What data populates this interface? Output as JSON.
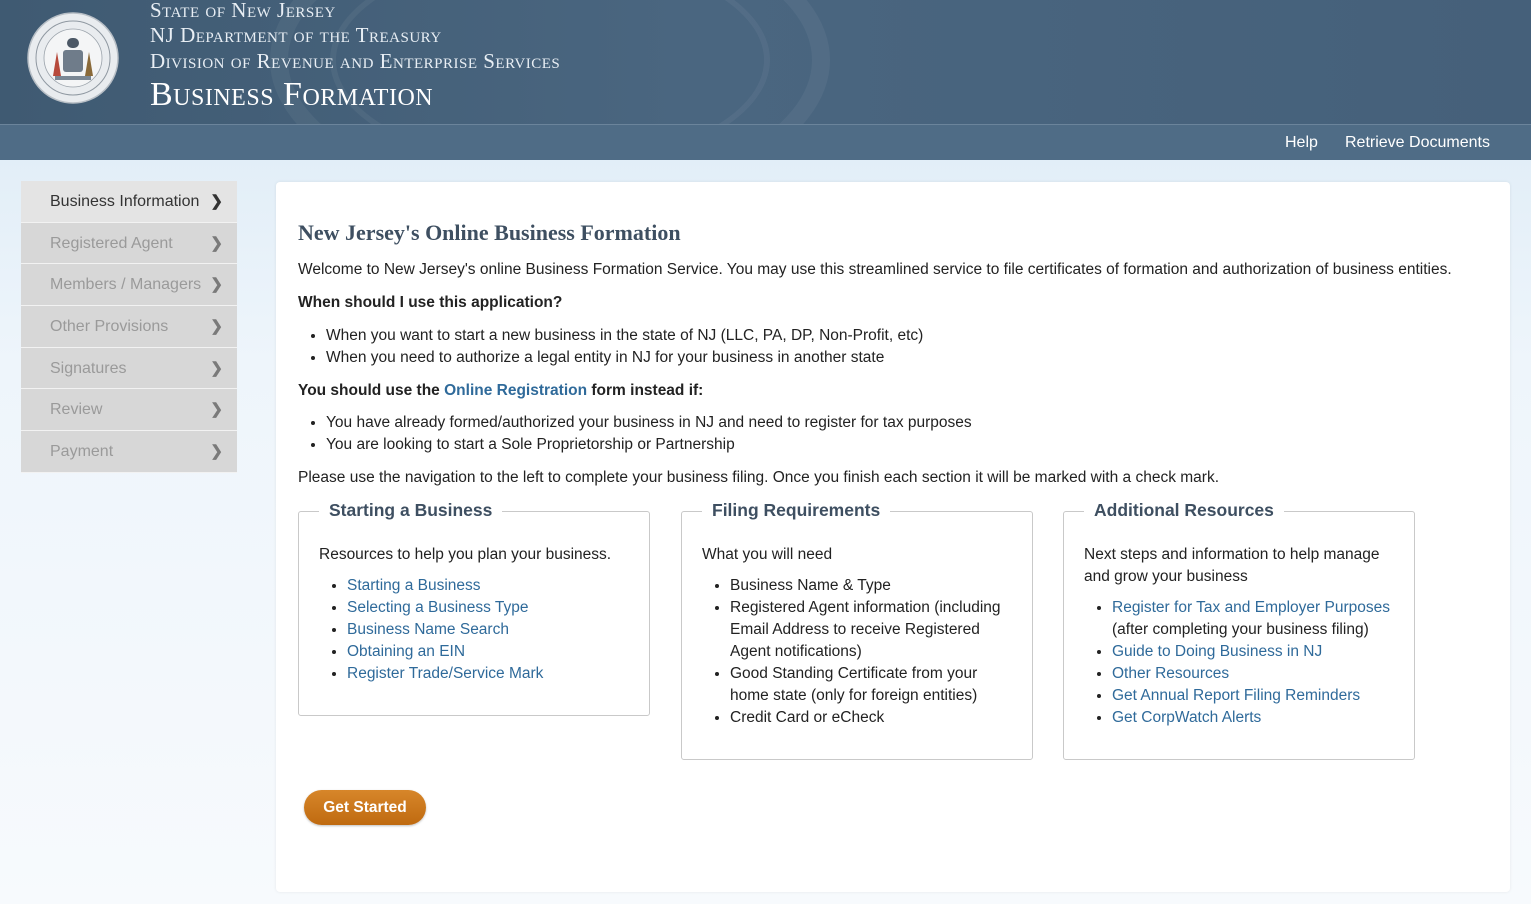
{
  "header": {
    "line1": "State of New Jersey",
    "line2": "NJ Department of the Treasury",
    "line3": "Division of Revenue and Enterprise Services",
    "title": "Business Formation"
  },
  "nav": {
    "help": "Help",
    "retrieve": "Retrieve Documents"
  },
  "sidebar": {
    "items": [
      {
        "label": "Business Information",
        "active": true
      },
      {
        "label": "Registered Agent"
      },
      {
        "label": "Members / Managers"
      },
      {
        "label": "Other Provisions"
      },
      {
        "label": "Signatures"
      },
      {
        "label": "Review"
      },
      {
        "label": "Payment"
      }
    ]
  },
  "main": {
    "title": "New Jersey's Online Business Formation",
    "welcome": "Welcome to New Jersey's online Business Formation Service. You may use this streamlined service to file certificates of formation and authorization of business entities.",
    "when_heading": "When should I use this application?",
    "when_items": [
      "When you want to start a new business in the state of NJ (LLC, PA, DP, Non-Profit, etc)",
      "When you need to authorize a legal entity in NJ for your business in another state"
    ],
    "instead_prefix": "You should use the ",
    "instead_link": "Online Registration",
    "instead_suffix": " form instead if:",
    "instead_items": [
      "You have already formed/authorized your business in NJ and need to register for tax purposes",
      "You are looking to start a Sole Proprietorship or Partnership"
    ],
    "navigation_note": "Please use the navigation to the left to complete your business filing. Once you finish each section it will be marked with a check mark.",
    "get_started": "Get Started"
  },
  "boxes": {
    "starting": {
      "title": "Starting a Business",
      "desc": "Resources to help you plan your business.",
      "links": [
        "Starting a Business",
        "Selecting a Business Type",
        "Business Name Search",
        "Obtaining an EIN",
        "Register Trade/Service Mark"
      ]
    },
    "filing": {
      "title": "Filing Requirements",
      "desc": "What you will need",
      "items": [
        "Business Name & Type",
        "Registered Agent information (including",
        "Email Address to receive Registered",
        "Agent notifications)",
        "Good Standing Certificate from your",
        "home state (only for foreign entities)",
        "Credit Card or eCheck"
      ]
    },
    "additional": {
      "title": "Additional Resources",
      "desc1": "Next steps and information to help manage",
      "desc2": "and grow your business",
      "link1": "Register for Tax and Employer Purposes",
      "link1_note": "(after completing your business filing)",
      "links": [
        "Guide to Doing Business in NJ",
        "Other Resources",
        "Get Annual Report Filing Reminders",
        "Get CorpWatch Alerts"
      ]
    }
  },
  "colors": {
    "header_bg": "#45607a",
    "navbar_bg": "#4f6c86",
    "link": "#2f6a9a",
    "button": "#c8741b"
  }
}
